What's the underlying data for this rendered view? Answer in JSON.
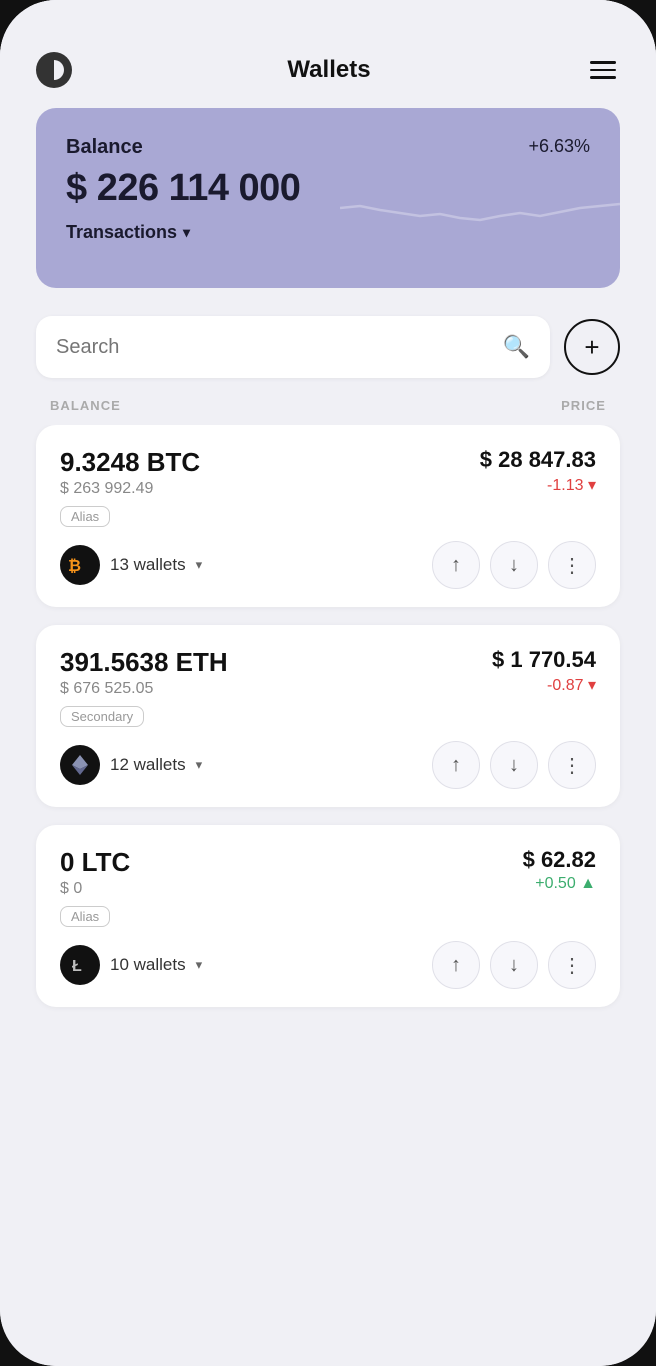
{
  "header": {
    "title": "Wallets",
    "menu_label": "menu"
  },
  "balance_card": {
    "label": "Balance",
    "percent": "+6.63%",
    "amount": "$ 226 114 000",
    "transactions_label": "Transactions"
  },
  "search": {
    "placeholder": "Search",
    "add_button_label": "+"
  },
  "columns": {
    "balance": "BALANCE",
    "price": "PRICE"
  },
  "cryptos": [
    {
      "id": "btc",
      "amount": "9.3248 BTC",
      "usd_value": "$ 263 992.49",
      "price": "$ 28 847.83",
      "change": "-1.13 ▾",
      "change_type": "negative",
      "alias": "Alias",
      "wallets_count": "13 wallets",
      "icon_symbol": "₿",
      "icon_class": "btc-icon"
    },
    {
      "id": "eth",
      "amount": "391.5638 ETH",
      "usd_value": "$ 676 525.05",
      "price": "$ 1 770.54",
      "change": "-0.87 ▾",
      "change_type": "negative",
      "alias": "Secondary",
      "wallets_count": "12 wallets",
      "icon_symbol": "Ξ",
      "icon_class": "eth-icon"
    },
    {
      "id": "ltc",
      "amount": "0 LTC",
      "usd_value": "$ 0",
      "price": "$ 62.82",
      "change": "+0.50 ▲",
      "change_type": "positive",
      "alias": "Alias",
      "wallets_count": "10 wallets",
      "icon_symbol": "Ł",
      "icon_class": "ltc-icon"
    }
  ]
}
